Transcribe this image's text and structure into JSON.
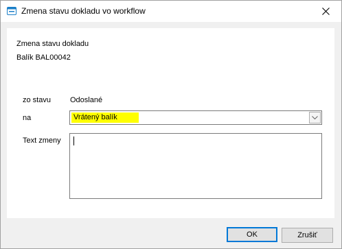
{
  "window": {
    "title": "Zmena stavu dokladu vo workflow",
    "icon": "app-window-icon",
    "close_icon": "close-icon"
  },
  "header": {
    "line1": "Zmena stavu dokladu",
    "line2": "Balík BAL00042"
  },
  "form": {
    "from_label": "zo stavu",
    "from_value": "Odoslané",
    "to_label": "na",
    "to_value": "Vrátený balík",
    "to_value_highlight": "#ffff00",
    "note_label": "Text zmeny",
    "note_value": ""
  },
  "buttons": {
    "ok": "OK",
    "cancel": "Zrušiť",
    "accent": "#0078d7"
  }
}
